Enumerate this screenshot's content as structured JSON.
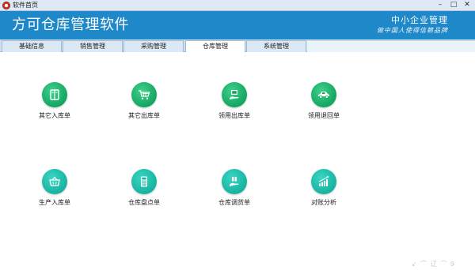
{
  "window": {
    "title": "软件首页",
    "controls": {
      "minimize": "–",
      "maximize": "□",
      "close": "✕"
    }
  },
  "header": {
    "brand": "方可仓库管理软件",
    "slogan_line1": "中小企业管理",
    "slogan_line2": "做中国人使得信赖品牌"
  },
  "tabs": [
    {
      "label": "基础信息",
      "active": false
    },
    {
      "label": "销售管理",
      "active": false
    },
    {
      "label": "采购管理",
      "active": false
    },
    {
      "label": "仓库管理",
      "active": true
    },
    {
      "label": "系统管理",
      "active": false
    }
  ],
  "tiles": [
    {
      "label": "其它入库单",
      "icon": "book-icon",
      "color": "#13a660"
    },
    {
      "label": "其它出库单",
      "icon": "cart-icon",
      "color": "#13a660"
    },
    {
      "label": "领用出库单",
      "icon": "monitor-hand-icon",
      "color": "#13a660"
    },
    {
      "label": "领用退回单",
      "icon": "car-icon",
      "color": "#13a660"
    },
    {
      "label": "生产入库单",
      "icon": "basket-icon",
      "color": "#17b3a0"
    },
    {
      "label": "仓库盘点单",
      "icon": "calculator-icon",
      "color": "#17b3a0"
    },
    {
      "label": "仓库调货单",
      "icon": "box-hand-icon",
      "color": "#17b3a0"
    },
    {
      "label": "对账分析",
      "icon": "bar-chart-icon",
      "color": "#17b3a0"
    }
  ],
  "watermark": "↙ ⌒ 辽 ⌒ 9"
}
